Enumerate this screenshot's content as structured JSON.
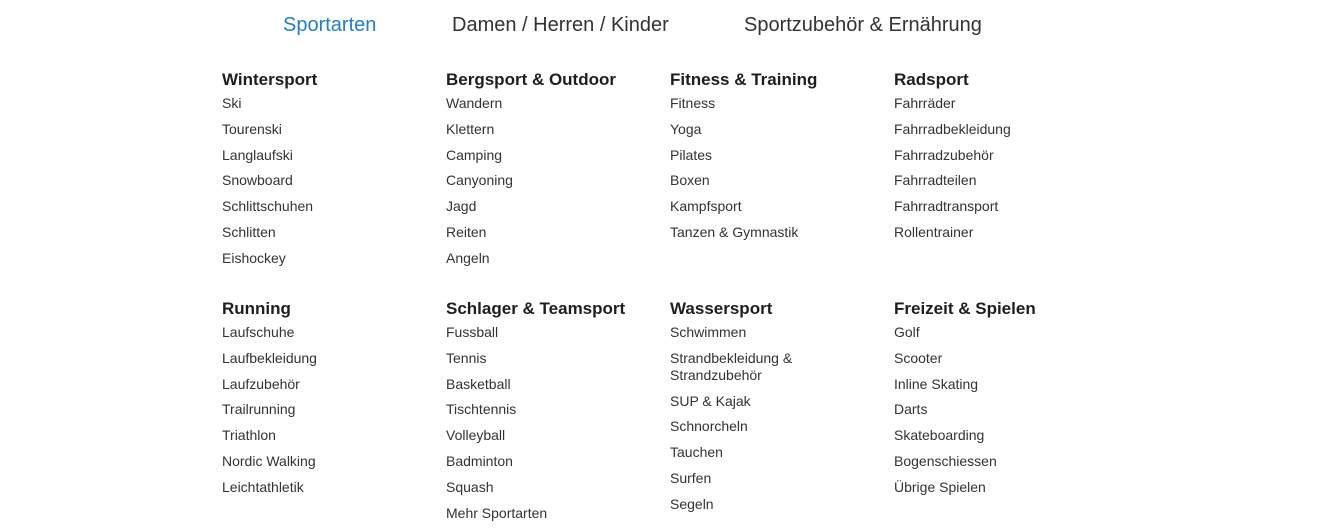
{
  "tabs": [
    {
      "label": "Sportarten",
      "active": true
    },
    {
      "label": "Damen / Herren / Kinder",
      "active": false
    },
    {
      "label": "Sportzubehör & Ernährung",
      "active": false
    }
  ],
  "accent_color": "#2280c9",
  "categories": [
    {
      "title": "Wintersport",
      "items": [
        "Ski",
        "Tourenski",
        "Langlaufski",
        "Snowboard",
        "Schlittschuhen",
        "Schlitten",
        "Eishockey"
      ]
    },
    {
      "title": "Bergsport & Outdoor",
      "items": [
        "Wandern",
        "Klettern",
        "Camping",
        "Canyoning",
        "Jagd",
        "Reiten",
        "Angeln"
      ]
    },
    {
      "title": "Fitness & Training",
      "items": [
        "Fitness",
        "Yoga",
        "Pilates",
        "Boxen",
        "Kampfsport",
        "Tanzen & Gymnastik"
      ]
    },
    {
      "title": "Radsport",
      "items": [
        "Fahrräder",
        "Fahrradbekleidung",
        "Fahrradzubehör",
        "Fahrradteilen",
        "Fahrradtransport",
        "Rollentrainer"
      ]
    },
    {
      "title": "Running",
      "items": [
        "Laufschuhe",
        "Laufbekleidung",
        "Laufzubehör",
        "Trailrunning",
        "Triathlon",
        "Nordic Walking",
        "Leichtathletik"
      ]
    },
    {
      "title": "Schlager & Teamsport",
      "items": [
        "Fussball",
        "Tennis",
        "Basketball",
        "Tischtennis",
        "Volleyball",
        "Badminton",
        "Squash",
        "Mehr Sportarten"
      ]
    },
    {
      "title": "Wassersport",
      "items": [
        "Schwimmen",
        "Strandbekleidung & Strandzubehör",
        "SUP & Kajak",
        "Schnorcheln",
        "Tauchen",
        "Surfen",
        "Segeln"
      ]
    },
    {
      "title": "Freizeit & Spielen",
      "items": [
        "Golf",
        "Scooter",
        "Inline Skating",
        "Darts",
        "Skateboarding",
        "Bogenschiessen",
        "Übrige Spielen"
      ]
    }
  ]
}
